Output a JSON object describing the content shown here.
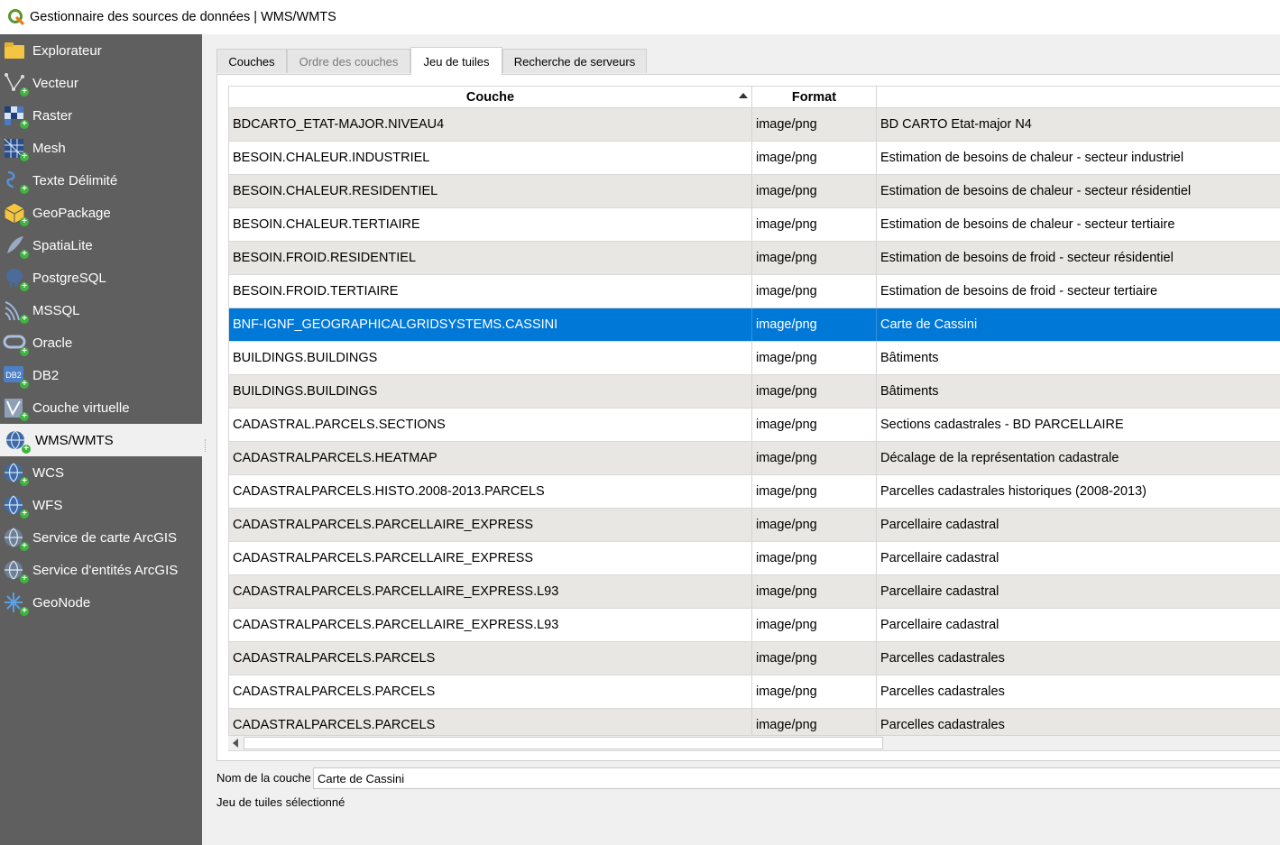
{
  "window": {
    "title": "Gestionnaire des sources de données | WMS/WMTS",
    "icon": "qgis-logo-icon"
  },
  "sidebar": {
    "items": [
      {
        "label": "Explorateur",
        "icon": "folder-icon"
      },
      {
        "label": "Vecteur",
        "icon": "vector-icon"
      },
      {
        "label": "Raster",
        "icon": "raster-icon"
      },
      {
        "label": "Mesh",
        "icon": "mesh-icon"
      },
      {
        "label": "Texte Délimité",
        "icon": "delimited-text-icon"
      },
      {
        "label": "GeoPackage",
        "icon": "geopackage-icon"
      },
      {
        "label": "SpatiaLite",
        "icon": "spatialite-icon"
      },
      {
        "label": "PostgreSQL",
        "icon": "postgresql-icon"
      },
      {
        "label": "MSSQL",
        "icon": "mssql-icon"
      },
      {
        "label": "Oracle",
        "icon": "oracle-icon"
      },
      {
        "label": "DB2",
        "icon": "db2-icon"
      },
      {
        "label": "Couche virtuelle",
        "icon": "virtual-layer-icon"
      },
      {
        "label": "WMS/WMTS",
        "icon": "wms-globe-icon",
        "selected": true
      },
      {
        "label": "WCS",
        "icon": "wcs-globe-icon"
      },
      {
        "label": "WFS",
        "icon": "wfs-globe-icon"
      },
      {
        "label": "Service de carte ArcGIS",
        "icon": "arcgis-map-icon"
      },
      {
        "label": "Service d'entités ArcGIS",
        "icon": "arcgis-feature-icon"
      },
      {
        "label": "GeoNode",
        "icon": "geonode-icon"
      }
    ]
  },
  "tabs": [
    {
      "label": "Couches",
      "state": "normal"
    },
    {
      "label": "Ordre des couches",
      "state": "disabled"
    },
    {
      "label": "Jeu de tuiles",
      "state": "active"
    },
    {
      "label": "Recherche de serveurs",
      "state": "normal"
    }
  ],
  "table": {
    "columns": [
      "Couche",
      "Format",
      ""
    ],
    "sort_column": "Couche",
    "selected_row": 6,
    "rows": [
      [
        "BDCARTO_ETAT-MAJOR.NIVEAU4",
        "image/png",
        "BD CARTO Etat-major N4"
      ],
      [
        "BESOIN.CHALEUR.INDUSTRIEL",
        "image/png",
        "Estimation de besoins de chaleur - secteur industriel"
      ],
      [
        "BESOIN.CHALEUR.RESIDENTIEL",
        "image/png",
        "Estimation de besoins de chaleur - secteur résidentiel"
      ],
      [
        "BESOIN.CHALEUR.TERTIAIRE",
        "image/png",
        "Estimation de besoins de chaleur - secteur tertiaire"
      ],
      [
        "BESOIN.FROID.RESIDENTIEL",
        "image/png",
        "Estimation de besoins de froid - secteur résidentiel"
      ],
      [
        "BESOIN.FROID.TERTIAIRE",
        "image/png",
        "Estimation de besoins de froid - secteur tertiaire"
      ],
      [
        "BNF-IGNF_GEOGRAPHICALGRIDSYSTEMS.CASSINI",
        "image/png",
        "Carte de Cassini"
      ],
      [
        "BUILDINGS.BUILDINGS",
        "image/png",
        "Bâtiments"
      ],
      [
        "BUILDINGS.BUILDINGS",
        "image/png",
        "Bâtiments"
      ],
      [
        "CADASTRAL.PARCELS.SECTIONS",
        "image/png",
        "Sections cadastrales - BD PARCELLAIRE"
      ],
      [
        "CADASTRALPARCELS.HEATMAP",
        "image/png",
        "Décalage de la représentation cadastrale"
      ],
      [
        "CADASTRALPARCELS.HISTO.2008-2013.PARCELS",
        "image/png",
        "Parcelles cadastrales historiques (2008-2013)"
      ],
      [
        "CADASTRALPARCELS.PARCELLAIRE_EXPRESS",
        "image/png",
        "Parcellaire cadastral"
      ],
      [
        "CADASTRALPARCELS.PARCELLAIRE_EXPRESS",
        "image/png",
        "Parcellaire cadastral"
      ],
      [
        "CADASTRALPARCELS.PARCELLAIRE_EXPRESS.L93",
        "image/png",
        "Parcellaire cadastral"
      ],
      [
        "CADASTRALPARCELS.PARCELLAIRE_EXPRESS.L93",
        "image/png",
        "Parcellaire cadastral"
      ],
      [
        "CADASTRALPARCELS.PARCELS",
        "image/png",
        "Parcelles cadastrales"
      ],
      [
        "CADASTRALPARCELS.PARCELS",
        "image/png",
        "Parcelles cadastrales"
      ],
      [
        "CADASTRALPARCELS.PARCELS",
        "image/png",
        "Parcelles cadastrales"
      ]
    ]
  },
  "layer_name": {
    "label": "Nom de la couche",
    "value": "Carte de Cassini"
  },
  "status": "Jeu de tuiles sélectionné",
  "colors": {
    "sidebar_bg": "#5f5f5f",
    "selection": "#0078d7",
    "alt_row": "#e9e7e3"
  }
}
